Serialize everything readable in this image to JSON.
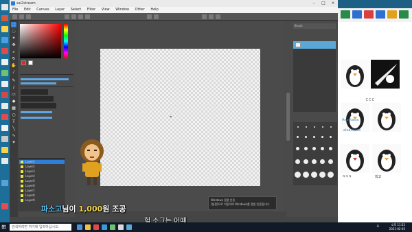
{
  "window": {
    "title": "sai2stream",
    "menu": [
      "File",
      "Edit",
      "Canvas",
      "Layer",
      "Select",
      "Filter",
      "View",
      "Window",
      "Other",
      "Help"
    ]
  },
  "panels": {
    "right_top": "Brush",
    "layers": [
      "Layer1",
      "Layer2",
      "Layer3",
      "Layer4",
      "Layer5",
      "Layer6",
      "Layer7",
      "Layer8",
      "Layer9"
    ]
  },
  "notification": {
    "line1": "Windows 정품 인증",
    "line2": "[설정]으로 이동하여 Windows를 정품 인증합니다."
  },
  "donation": {
    "name": "파소고",
    "mid": "님이 ",
    "amount": "1,000",
    "suffix": "원 조공"
  },
  "subtitle": "헐 소그는 어떼",
  "chat": {
    "lines": [
      "ㄷㄷㄷ",
      "Anastasia",
      "alvachaos",
      "ㅋㅋㅋ",
      "최고"
    ]
  },
  "taskbar": {
    "search_placeholder": "검색하려면 여기에 입력하십시오.",
    "time": "오후 11:52",
    "date": "2021-02-05",
    "lang": "A"
  },
  "colors": {
    "desktop": "#1d6f9a",
    "accent": "#5aa8d8",
    "chat_top": "#1d5f85"
  }
}
